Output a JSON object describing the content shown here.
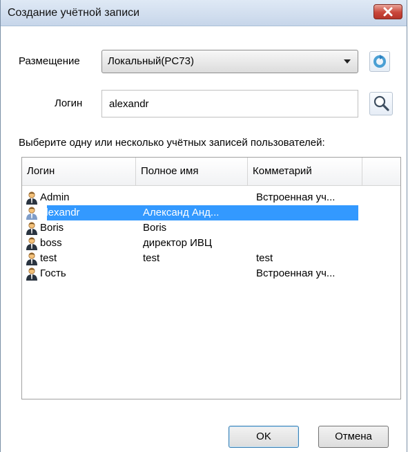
{
  "window": {
    "title": "Создание учётной записи",
    "close_label": "x"
  },
  "placement": {
    "label": "Размещение",
    "value": "Локальный(PC73)"
  },
  "login": {
    "label": "Логин",
    "value": "alexandr"
  },
  "list": {
    "instruction": "Выберите одну или несколько учётных записей пользователей:",
    "columns": [
      "Логин",
      "Полное имя",
      "Комметарий"
    ],
    "rows": [
      {
        "login": "Admin",
        "fullname": "",
        "comment": "Встроенная уч...",
        "selected": false
      },
      {
        "login": "alexandr",
        "fullname": "Александ Анд...",
        "comment": "",
        "selected": true
      },
      {
        "login": "Boris",
        "fullname": "Boris",
        "comment": "",
        "selected": false
      },
      {
        "login": "boss",
        "fullname": "директор ИВЦ",
        "comment": "",
        "selected": false
      },
      {
        "login": "test",
        "fullname": "test",
        "comment": "test",
        "selected": false
      },
      {
        "login": "Гость",
        "fullname": "",
        "comment": "Встроенная уч...",
        "selected": false
      }
    ]
  },
  "buttons": {
    "ok": "OK",
    "cancel": "Отмена"
  },
  "icons": {
    "user": "user-icon",
    "refresh": "refresh-icon",
    "search": "search-icon"
  },
  "colors": {
    "selection": "#3399ff",
    "close": "#c9463a"
  }
}
